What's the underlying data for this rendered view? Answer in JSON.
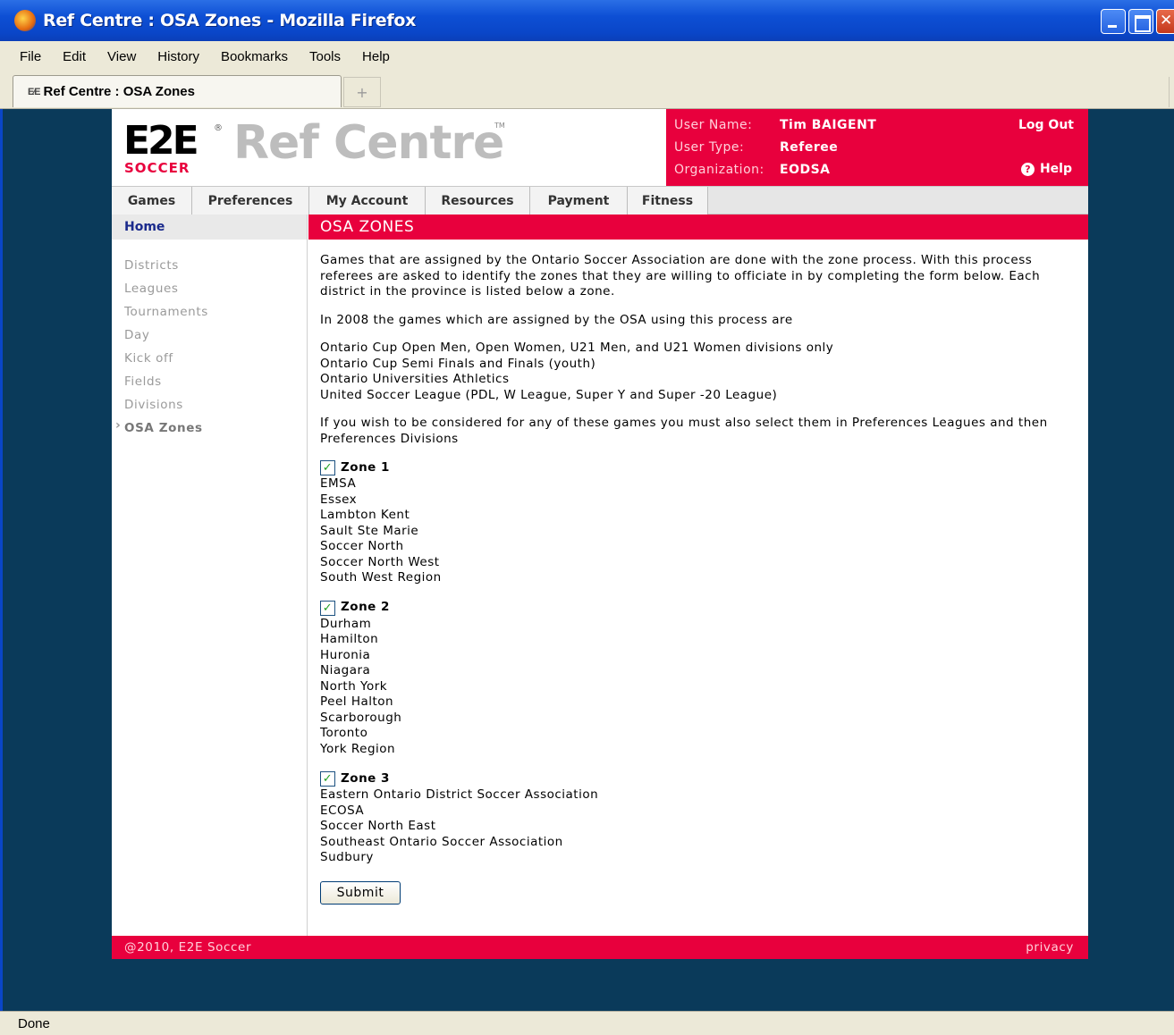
{
  "window": {
    "title": "Ref Centre : OSA Zones - Mozilla Firefox"
  },
  "menu": [
    "File",
    "Edit",
    "View",
    "History",
    "Bookmarks",
    "Tools",
    "Help"
  ],
  "tab": {
    "favicon_text": "E⁄E",
    "label": "Ref Centre : OSA Zones",
    "new_tab": "+"
  },
  "status": "Done",
  "header": {
    "logo_e2e": "E2E",
    "logo_soccer": "SOCCER",
    "logo_ref": "Ref Centre",
    "logo_reg": "®",
    "logo_tm": "TM",
    "user_name_label": "User Name:",
    "user_name": "Tim BAIGENT",
    "user_type_label": "User Type:",
    "user_type": "Referee",
    "org_label": "Organization:",
    "org": "EODSA",
    "logout": "Log Out",
    "help": "Help",
    "help_icon": "?"
  },
  "nav": [
    "Games",
    "Preferences",
    "My Account",
    "Resources",
    "Payment",
    "Fitness"
  ],
  "sidebar": {
    "home": "Home",
    "items": [
      "Districts",
      "Leagues",
      "Tournaments",
      "Day",
      "Kick off",
      "Fields",
      "Divisions",
      "OSA Zones"
    ]
  },
  "main": {
    "title": "OSA ZONES",
    "intro": "Games that are assigned by the Ontario Soccer Association are done with the zone process. With this process referees are asked to identify the zones that they are willing to officiate in by completing the form below. Each district in the province is listed below a zone.",
    "year_text": "In 2008 the games which are assigned by the OSA using this process are",
    "competitions": [
      "Ontario Cup Open Men, Open Women, U21 Men, and U21 Women divisions only",
      "Ontario Cup Semi Finals and Finals (youth)",
      "Ontario Universities Athletics",
      "United Soccer League (PDL, W League, Super Y and Super -20 League)"
    ],
    "preferences_note": "If you wish to be considered for any of these games you must also select them in Preferences Leagues and then Preferences Divisions",
    "zones": [
      {
        "title": "Zone 1",
        "checked": true,
        "districts": [
          "EMSA",
          "Essex",
          "Lambton Kent",
          "Sault Ste Marie",
          "Soccer North",
          "Soccer North West",
          "South West Region"
        ]
      },
      {
        "title": "Zone 2",
        "checked": true,
        "districts": [
          "Durham",
          "Hamilton",
          "Huronia",
          "Niagara",
          "North York",
          "Peel Halton",
          "Scarborough",
          "Toronto",
          "York Region"
        ]
      },
      {
        "title": "Zone 3",
        "checked": true,
        "districts": [
          "Eastern Ontario District Soccer Association",
          "ECOSA",
          "Soccer North East",
          "Southeast Ontario Soccer Association",
          "Sudbury"
        ]
      }
    ],
    "submit": "Submit"
  },
  "footer": {
    "copyright": "@2010, E2E Soccer",
    "privacy": "privacy"
  },
  "colors": {
    "brand_red": "#e8003d",
    "page_bg": "#0a3a5a",
    "nav_link": "#1a2a8c"
  }
}
